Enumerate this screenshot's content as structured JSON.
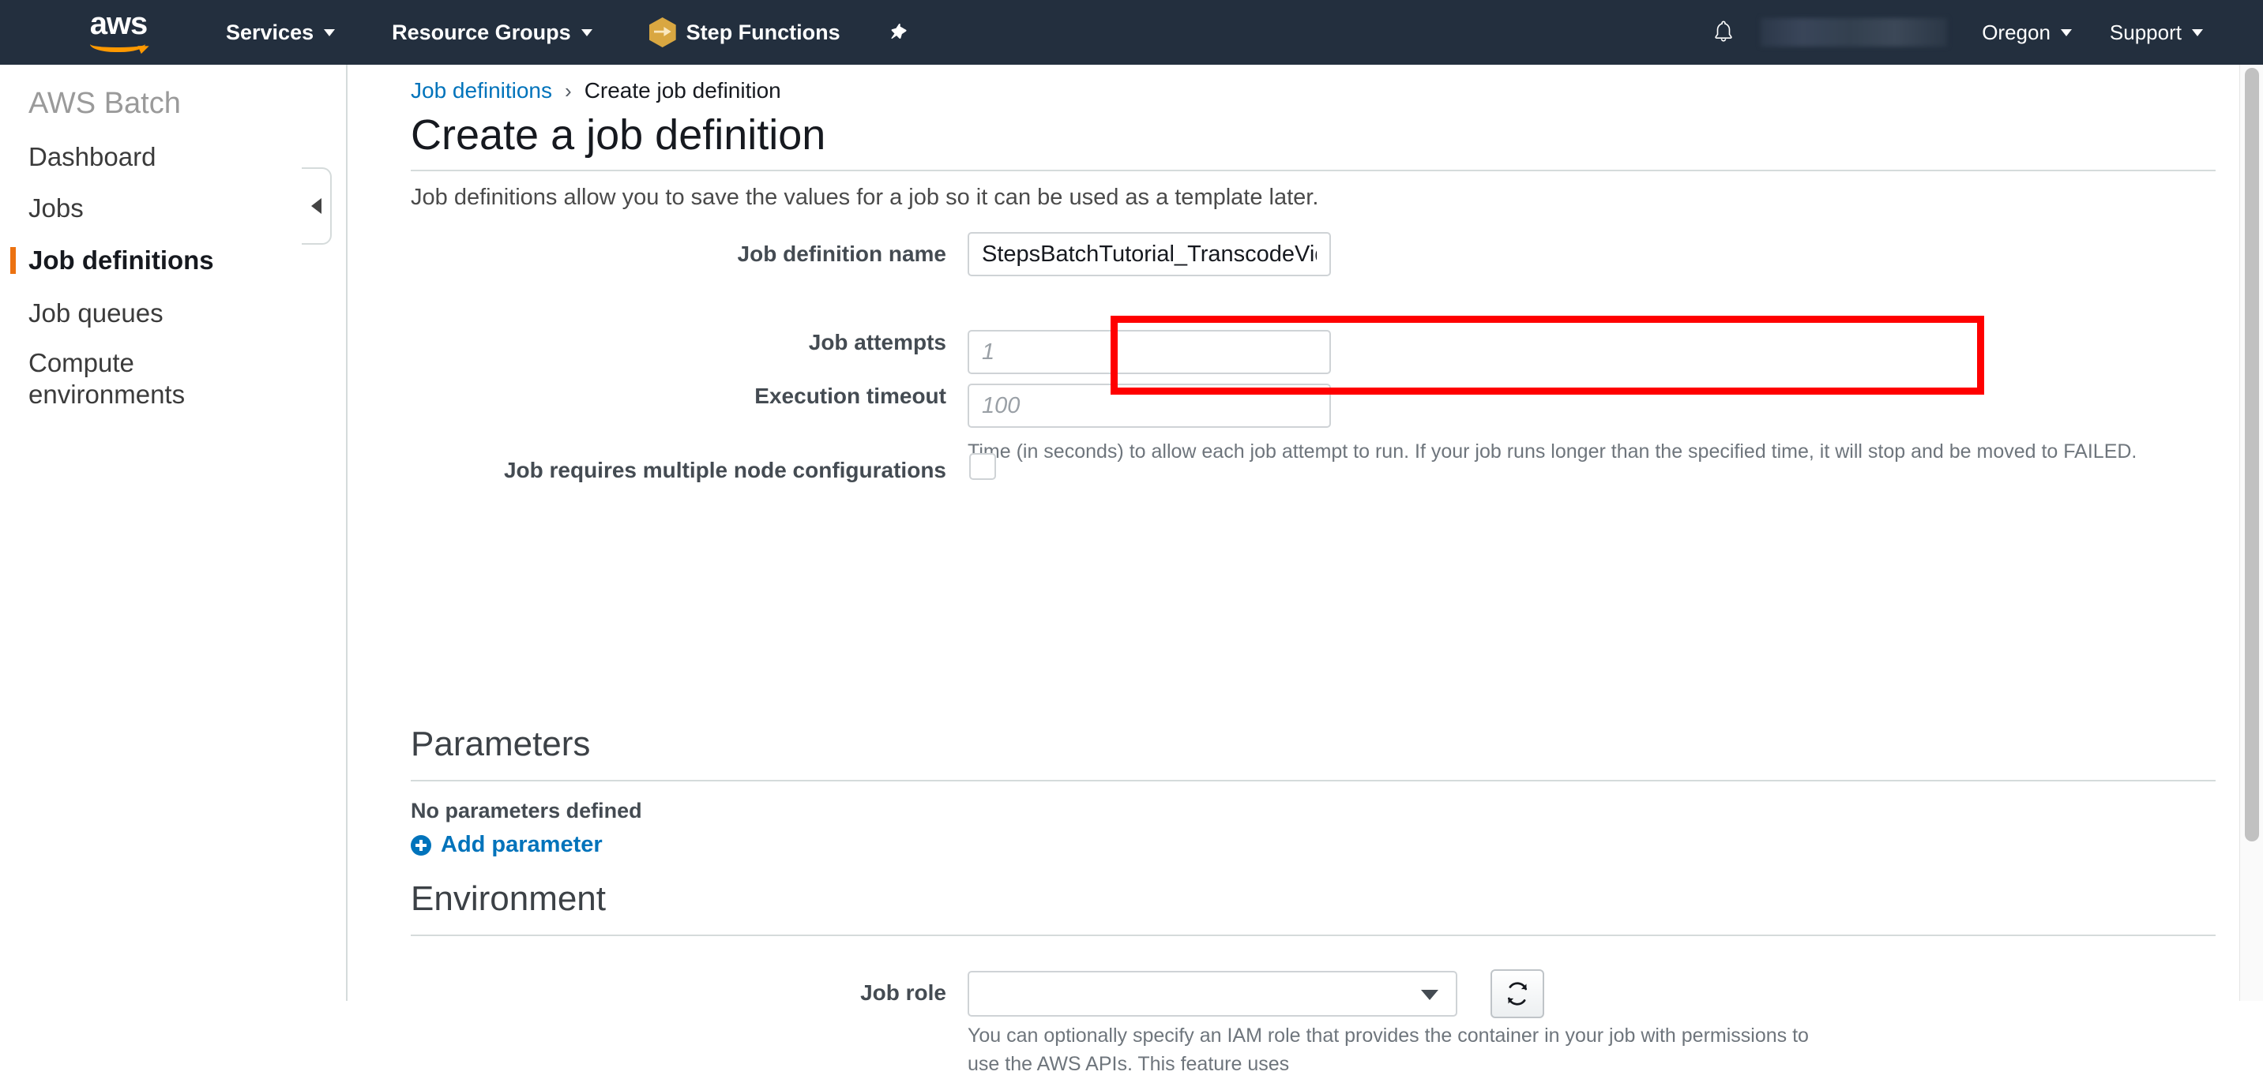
{
  "topnav": {
    "logo_text": "aws",
    "logo_alt": "aws-logo",
    "services_label": "Services",
    "resource_groups_label": "Resource Groups",
    "step_functions_label": "Step Functions",
    "pin_label": "",
    "account_label": "",
    "region_label": "Oregon",
    "support_label": "Support",
    "background_color": "#232f3e",
    "accent_color": "#ff9900"
  },
  "sidebar": {
    "title": "AWS Batch",
    "items": [
      {
        "label": "Dashboard",
        "active": false
      },
      {
        "label": "Jobs",
        "active": false
      },
      {
        "label": "Job definitions",
        "active": true
      },
      {
        "label": "Job queues",
        "active": false
      },
      {
        "label": "Compute environments",
        "active": false
      }
    ],
    "active_marker_color": "#ec7211"
  },
  "breadcrumb": {
    "parent": "Job definitions",
    "separator": "›",
    "current": "Create job definition",
    "link_color": "#0073bb"
  },
  "page": {
    "title": "Create a job definition",
    "subtitle": "Job definitions allow you to save the values for a job so it can be used as a template later."
  },
  "form": {
    "job_definition_name": {
      "label": "Job definition name",
      "value": "StepsBatchTutorial_TranscodeVideo",
      "placeholder": "",
      "highlighted": true,
      "highlight_color": "#ff0000"
    },
    "job_attempts": {
      "label": "Job attempts",
      "value": "",
      "placeholder": "1"
    },
    "execution_timeout": {
      "label": "Execution timeout",
      "value": "",
      "placeholder": "100",
      "help": "Time (in seconds) to allow each job attempt to run. If your job runs longer than the specified time, it will stop and be moved to FAILED."
    },
    "multiple_node_configurations": {
      "label": "Job requires multiple node configurations",
      "checked": false
    }
  },
  "parameters_section": {
    "heading": "Parameters",
    "empty_text": "No parameters defined",
    "add_label": "Add parameter"
  },
  "environment_section": {
    "heading": "Environment",
    "job_role": {
      "label": "Job role",
      "selected_value": "",
      "help": "You can optionally specify an IAM role that provides the container in your job with permissions to use the AWS APIs. This feature uses",
      "refresh_label": ""
    }
  },
  "icons": {
    "bell": "bell-icon",
    "pin": "pin-icon",
    "step_functions": "step-functions-icon",
    "chevron_down": "chevron-down-icon",
    "plus_circle": "plus-circle-icon",
    "refresh": "refresh-icon",
    "collapse_arrow": "collapse-left-icon"
  }
}
